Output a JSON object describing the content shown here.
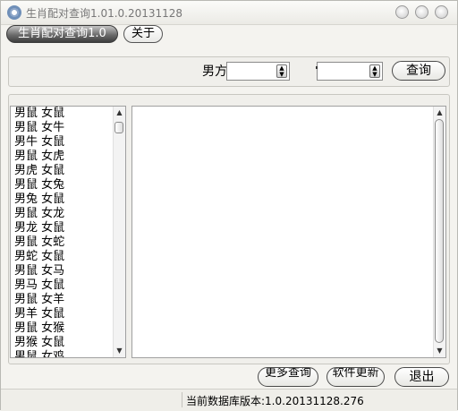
{
  "window": {
    "title": "生肖配对查询1.01.0.20131128"
  },
  "tabs": {
    "main_label": "生肖配对查询1.0",
    "about_label": "关于"
  },
  "query": {
    "male_label": "男方",
    "male_value": "",
    "female_value": "",
    "query_button": "查询"
  },
  "pair_list": [
    "男鼠 女鼠",
    "男鼠 女牛",
    "男牛 女鼠",
    "男鼠 女虎",
    "男虎 女鼠",
    "男鼠 女兔",
    "男兔 女鼠",
    "男鼠 女龙",
    "男龙 女鼠",
    "男鼠 女蛇",
    "男蛇 女鼠",
    "男鼠 女马",
    "男马 女鼠",
    "男鼠 女羊",
    "男羊 女鼠",
    "男鼠 女猴",
    "男猴 女鼠",
    "男鼠 女鸡"
  ],
  "buttons": {
    "more_query": "更多查询",
    "software_update": "软件更新",
    "exit": "退出"
  },
  "status": {
    "db_version": "当前数据库版本:1.0.20131128.276"
  }
}
